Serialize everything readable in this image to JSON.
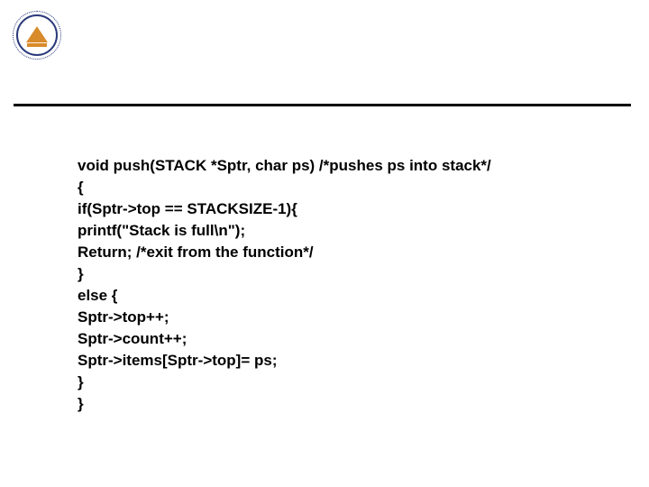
{
  "code_lines": [
    "void push(STACK *Sptr, char ps) /*pushes ps into stack*/",
    "{",
    "if(Sptr->top == STACKSIZE-1){",
    "printf(\"Stack is full\\n\");",
    "Return; /*exit from the function*/",
    "}",
    "else {",
    "Sptr->top++;",
    "Sptr->count++;",
    "Sptr->items[Sptr->top]= ps;",
    "}",
    "}"
  ]
}
